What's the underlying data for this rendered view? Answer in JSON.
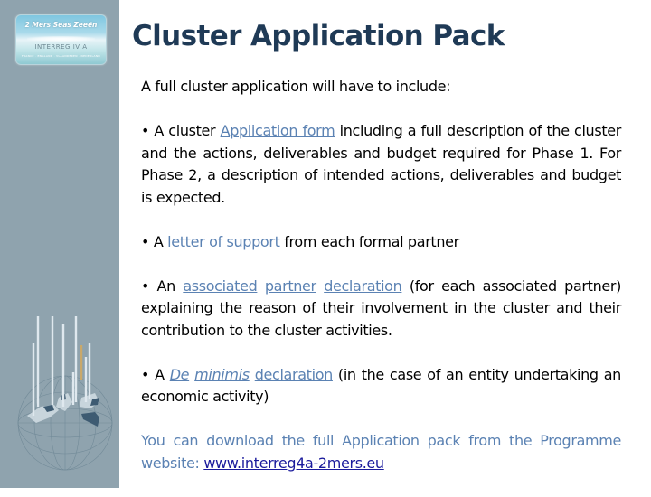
{
  "logo": {
    "name": "2 Mers Seas Zeeën",
    "programme": "INTERREG IV A",
    "countries": "FRANCE · ENGLAND · VLAANDEREN · NEDERLAND"
  },
  "title": "Cluster Application Pack",
  "intro": "A full cluster application will have to include:",
  "items": [
    {
      "bullet": "•",
      "pre": " A cluster ",
      "links": [
        "Application form"
      ],
      "post": " including a full description of the cluster and the actions, deliverables and budget required for Phase 1. For Phase 2, a description of intended actions, deliverables and budget is expected."
    },
    {
      "bullet": "•",
      "pre": " A ",
      "links": [
        "letter of support "
      ],
      "post": "from each formal partner"
    },
    {
      "bullet": "•",
      "pre": " An ",
      "links": [
        "associated",
        "partner",
        "declaration"
      ],
      "post": " (for each associated partner) explaining the reason of their involvement in the cluster and their contribution to the cluster activities."
    },
    {
      "bullet": "•",
      "pre": " A ",
      "links_italic": [
        "De",
        "minimis"
      ],
      "links": [
        "declaration"
      ],
      "post": " (in the case of an entity undertaking an economic activity)"
    }
  ],
  "download": {
    "text": "You can download the full Application pack from the Programme website: ",
    "url_text": "www.interreg4a-2mers.eu"
  },
  "colors": {
    "sidebar": "#8fa3ae",
    "title": "#1f3a56",
    "link": "#5b82b3",
    "url": "#1a1a9c"
  }
}
